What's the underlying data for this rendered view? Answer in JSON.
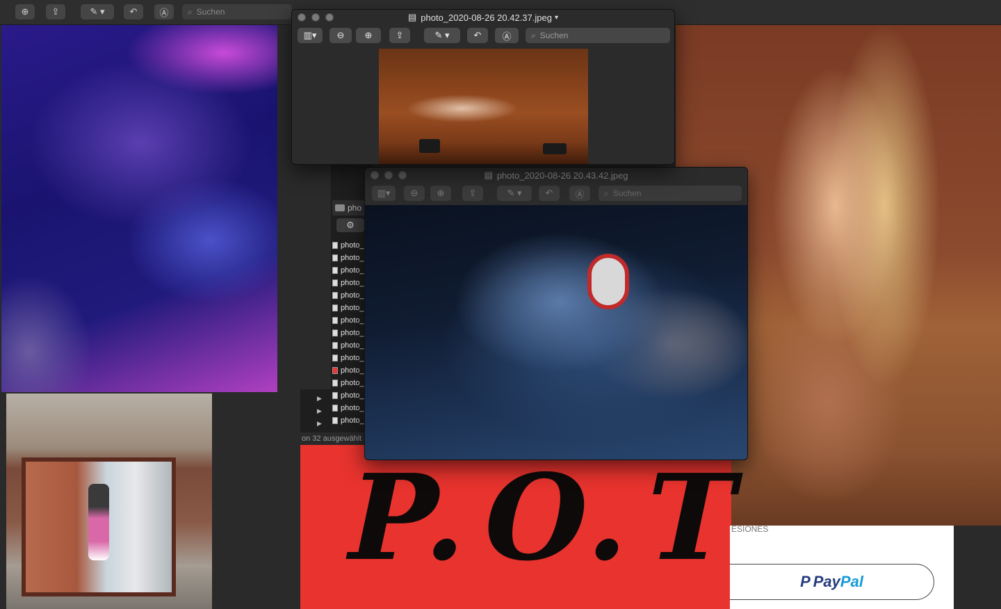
{
  "background_window": {
    "search_placeholder": "Suchen"
  },
  "finder": {
    "folder_label": "pho",
    "files": [
      "photo_",
      "photo_",
      "photo_",
      "photo_",
      "photo_",
      "photo_",
      "photo_",
      "photo_",
      "photo_",
      "photo_",
      "photo_",
      "photo_",
      "photo_",
      "photo_",
      "photo_"
    ],
    "status": "on 32 ausgewählt"
  },
  "window_front": {
    "title": "photo_2020-08-26 20.42.37.jpeg",
    "search_placeholder": "Suchen"
  },
  "window_back": {
    "title": "photo_2020-08-26 20.43.42.jpeg",
    "search_placeholder": "Suchen"
  },
  "poster": {
    "text": "P.O.T"
  },
  "web_page": {
    "partial_label": "ESIONES",
    "paypal_part1": "Pay",
    "paypal_part2": "Pal"
  },
  "colors": {
    "poster_red": "#e8332e",
    "paypal_dark": "#253b80",
    "paypal_light": "#179bd7"
  }
}
